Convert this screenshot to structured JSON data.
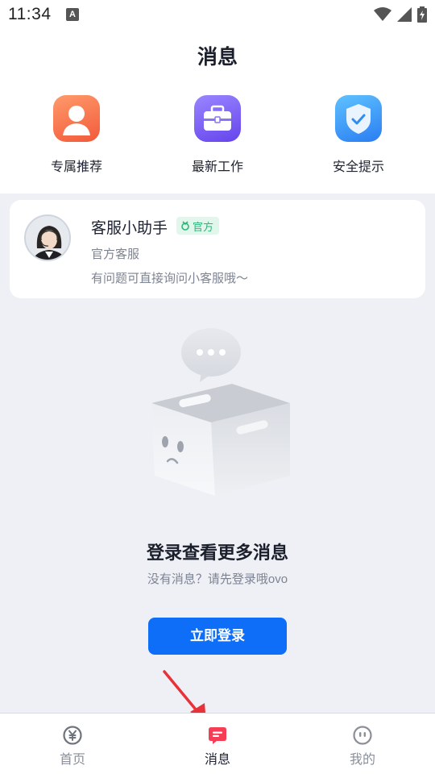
{
  "status_bar": {
    "time": "11:34",
    "notification_letter": "A"
  },
  "header": {
    "title": "消息"
  },
  "quick_actions": [
    {
      "label": "专属推荐",
      "icon": "person-icon",
      "color": "#f6693f"
    },
    {
      "label": "最新工作",
      "icon": "briefcase-icon",
      "color": "#7257f1"
    },
    {
      "label": "安全提示",
      "icon": "shield-check-icon",
      "color": "#2f8cf5"
    }
  ],
  "service_card": {
    "name": "客服小助手",
    "badge": "官方",
    "subtitle": "官方客服",
    "description": "有问题可直接询问小客服哦～"
  },
  "empty_state": {
    "title": "登录查看更多消息",
    "subtitle": "没有消息？请先登录哦ovo",
    "button": "立即登录"
  },
  "tabbar": {
    "items": [
      {
        "label": "首页",
        "icon": "yen-circle-icon",
        "active": false
      },
      {
        "label": "消息",
        "icon": "message-icon",
        "active": true
      },
      {
        "label": "我的",
        "icon": "face-icon",
        "active": false
      }
    ]
  },
  "colors": {
    "accent": "#0f6ef8",
    "active_tab": "#f53d55",
    "badge": "#2cb57a",
    "arrow": "#e8323a"
  }
}
